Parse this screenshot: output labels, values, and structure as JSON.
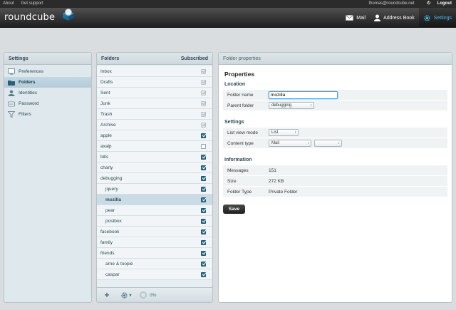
{
  "topline": {
    "about": "About",
    "support": "Get support",
    "user": "thomas@roundcube.net",
    "logout": "Logout"
  },
  "header": {
    "logo": "roundcube",
    "nav": [
      {
        "label": "Mail"
      },
      {
        "label": "Address Book"
      },
      {
        "label": "Settings",
        "active": true
      }
    ]
  },
  "settings": {
    "title": "Settings",
    "items": [
      {
        "label": "Preferences",
        "icon": "preferences-icon"
      },
      {
        "label": "Folders",
        "icon": "folders-icon",
        "selected": true
      },
      {
        "label": "Identities",
        "icon": "identities-icon"
      },
      {
        "label": "Password",
        "icon": "password-icon"
      },
      {
        "label": "Filters",
        "icon": "filters-icon"
      }
    ]
  },
  "folders": {
    "title": "Folders",
    "subscribed_label": "Subscribed",
    "rows": [
      {
        "name": "Inbox",
        "state": "disabled"
      },
      {
        "name": "Drafts",
        "state": "disabled"
      },
      {
        "name": "Sent",
        "state": "disabled"
      },
      {
        "name": "Junk",
        "state": "disabled"
      },
      {
        "name": "Trash",
        "state": "disabled"
      },
      {
        "name": "Archive",
        "state": "disabled"
      },
      {
        "name": "apple",
        "state": "on"
      },
      {
        "name": "axalp",
        "state": "off"
      },
      {
        "name": "bills",
        "state": "on"
      },
      {
        "name": "charly",
        "state": "on"
      },
      {
        "name": "debugging",
        "state": "on"
      },
      {
        "name": "jquery",
        "state": "on",
        "child": true
      },
      {
        "name": "mozilla",
        "state": "on",
        "child": true,
        "selected": true
      },
      {
        "name": "pear",
        "state": "on",
        "child": true
      },
      {
        "name": "postbox",
        "state": "on",
        "child": true
      },
      {
        "name": "facebook",
        "state": "on"
      },
      {
        "name": "family",
        "state": "on"
      },
      {
        "name": "friends",
        "state": "on"
      },
      {
        "name": "arne & toopie",
        "state": "on",
        "child": true
      },
      {
        "name": "caspar",
        "state": "on",
        "child": true
      }
    ],
    "quota": "0%"
  },
  "properties": {
    "header": "Folder properties",
    "title": "Properties",
    "location": {
      "heading": "Location",
      "folder_name_label": "Folder name",
      "folder_name_value": "mozilla",
      "parent_label": "Parent folder",
      "parent_value": "debugging"
    },
    "settings": {
      "heading": "Settings",
      "list_view_label": "List view mode",
      "list_view_value": "List",
      "content_type_label": "Content type",
      "content_type_value": "Mail",
      "content_type_second": ""
    },
    "information": {
      "heading": "Information",
      "rows": [
        {
          "label": "Messages",
          "value": "151"
        },
        {
          "label": "Size",
          "value": "272 KB"
        },
        {
          "label": "Folder Type",
          "value": "Private Folder"
        }
      ]
    },
    "save_label": "Save"
  }
}
